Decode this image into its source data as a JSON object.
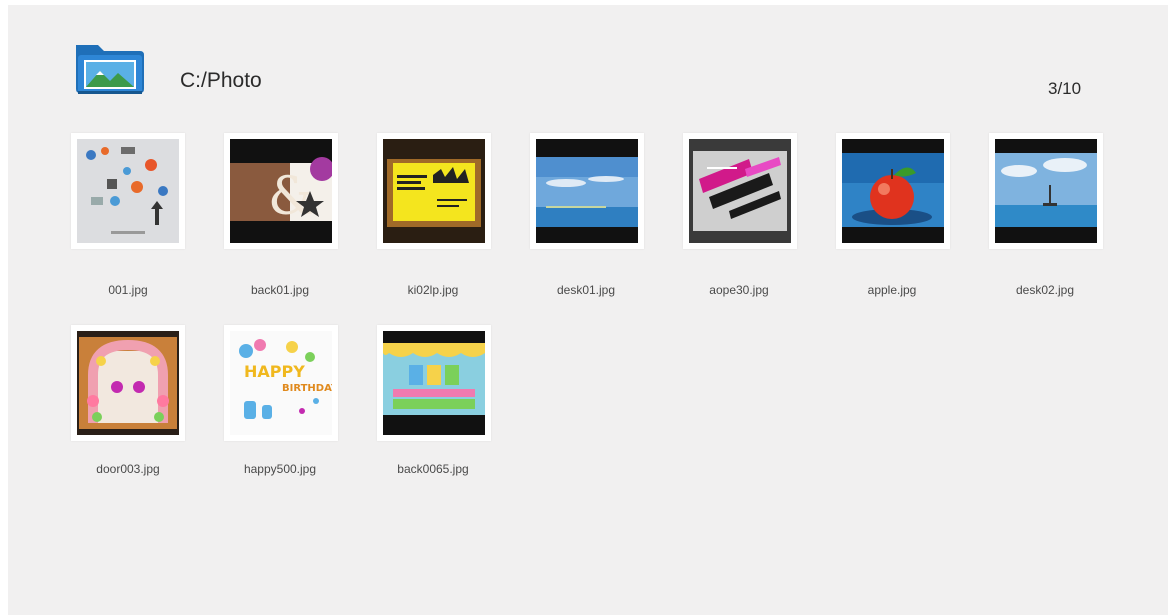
{
  "header": {
    "path": "C:/Photo",
    "page_indicator": "3/10",
    "folder_icon": "photo-folder-icon"
  },
  "colors": {
    "background": "#f1f0f0",
    "folder_blue": "#1f6fb8",
    "text": "#2b2b2b"
  },
  "files": [
    {
      "name": "001.jpg",
      "thumb": "infographic"
    },
    {
      "name": "back01.jpg",
      "thumb": "ampersand"
    },
    {
      "name": "ki02lp.jpg",
      "thumb": "yellow-card"
    },
    {
      "name": "desk01.jpg",
      "thumb": "sea-horizon"
    },
    {
      "name": "aope30.jpg",
      "thumb": "collage"
    },
    {
      "name": "apple.jpg",
      "thumb": "apple"
    },
    {
      "name": "desk02.jpg",
      "thumb": "sea-boat"
    },
    {
      "name": "door003.jpg",
      "thumb": "balloon-arch"
    },
    {
      "name": "happy500.jpg",
      "thumb": "birthday"
    },
    {
      "name": "back0065.jpg",
      "thumb": "party-banner"
    }
  ]
}
